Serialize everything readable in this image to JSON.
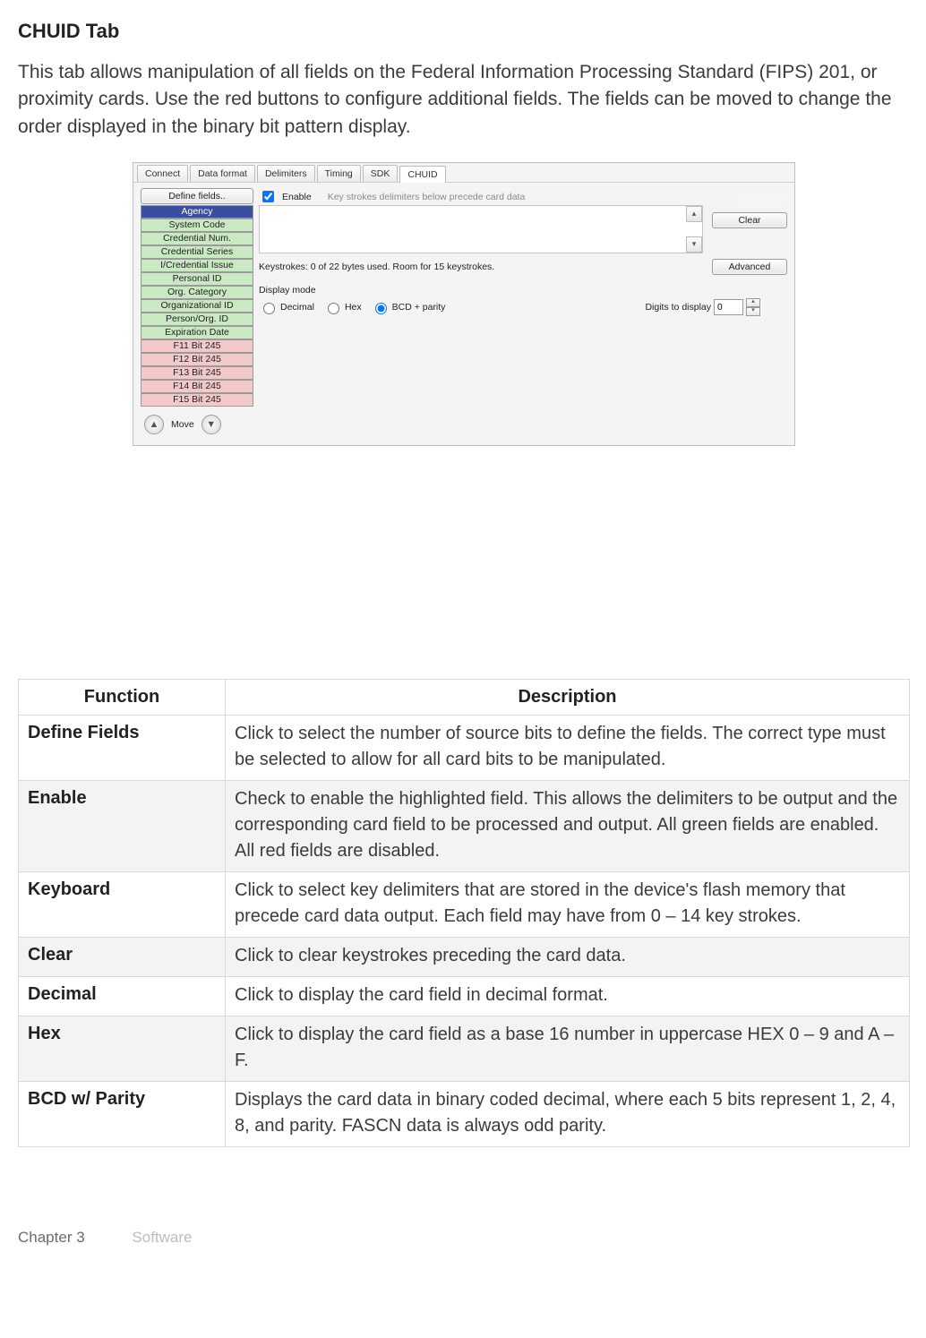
{
  "title": "CHUID Tab",
  "intro": "This tab allows manipulation of all fields on the Federal Information Processing Standard (FIPS) 201, or proximity cards. Use the red buttons to configure additional fields. The fields can be moved to change the order displayed in the binary bit pattern display.",
  "screenshot": {
    "tabs": [
      "Connect",
      "Data format",
      "Delimiters",
      "Timing",
      "SDK",
      "CHUID"
    ],
    "active_tab_index": 5,
    "define_fields_btn": "Define fields..",
    "fields": [
      {
        "label": "Agency",
        "state": "selected"
      },
      {
        "label": "System Code",
        "state": "green"
      },
      {
        "label": "Credential Num.",
        "state": "green"
      },
      {
        "label": "Credential Series",
        "state": "green"
      },
      {
        "label": "I/Credential Issue",
        "state": "green"
      },
      {
        "label": "Personal ID",
        "state": "green"
      },
      {
        "label": "Org. Category",
        "state": "green"
      },
      {
        "label": "Organizational ID",
        "state": "green"
      },
      {
        "label": "Person/Org. ID",
        "state": "green"
      },
      {
        "label": "Expiration Date",
        "state": "green"
      },
      {
        "label": "F11 Bit 245",
        "state": "red"
      },
      {
        "label": "F12 Bit 245",
        "state": "red"
      },
      {
        "label": "F13 Bit 245",
        "state": "red"
      },
      {
        "label": "F14 Bit 245",
        "state": "red"
      },
      {
        "label": "F15 Bit 245",
        "state": "red"
      }
    ],
    "move_label": "Move",
    "enable_label": "Enable",
    "hint": "Key strokes delimiters below precede card data",
    "keystroke_info": "Keystrokes: 0 of 22 bytes used. Room for 15 keystrokes.",
    "clear_btn": "Clear",
    "advanced_btn": "Advanced",
    "display_mode_label": "Display mode",
    "radios": {
      "decimal": "Decimal",
      "hex": "Hex",
      "bcd": "BCD  + parity"
    },
    "radio_selected": "bcd",
    "digits_label": "Digits to display",
    "digits_value": "0"
  },
  "table": {
    "headers": {
      "function": "Function",
      "description": "Description"
    },
    "rows": [
      {
        "fn": "Define Fields",
        "desc": "Click to select the number of source bits to define the fields. The correct type must be selected to allow for all card bits to be manipulated."
      },
      {
        "fn": "Enable",
        "desc": "Check to enable the highlighted field. This allows the delimiters to be output and the corresponding card field to be processed and output. All green fields are enabled. All red fields are disabled."
      },
      {
        "fn": "Keyboard",
        "desc": "Click to select key delimiters that are stored in the device's flash memory that precede card data output. Each field may have from 0 – 14 key strokes."
      },
      {
        "fn": "Clear",
        "desc": "Click to clear keystrokes preceding the card data."
      },
      {
        "fn": "Decimal",
        "desc": "Click to display the card field in decimal format."
      },
      {
        "fn": "Hex",
        "desc": "Click to display the card field as a base 16 number in uppercase HEX 0 – 9 and A – F."
      },
      {
        "fn": "BCD w/ Parity",
        "desc": "Displays the card data in binary coded decimal, where each 5 bits represent 1, 2, 4, 8, and parity. FASCN data is always odd parity."
      }
    ]
  },
  "footer": {
    "chapter": "Chapter 3",
    "section": "Software"
  }
}
